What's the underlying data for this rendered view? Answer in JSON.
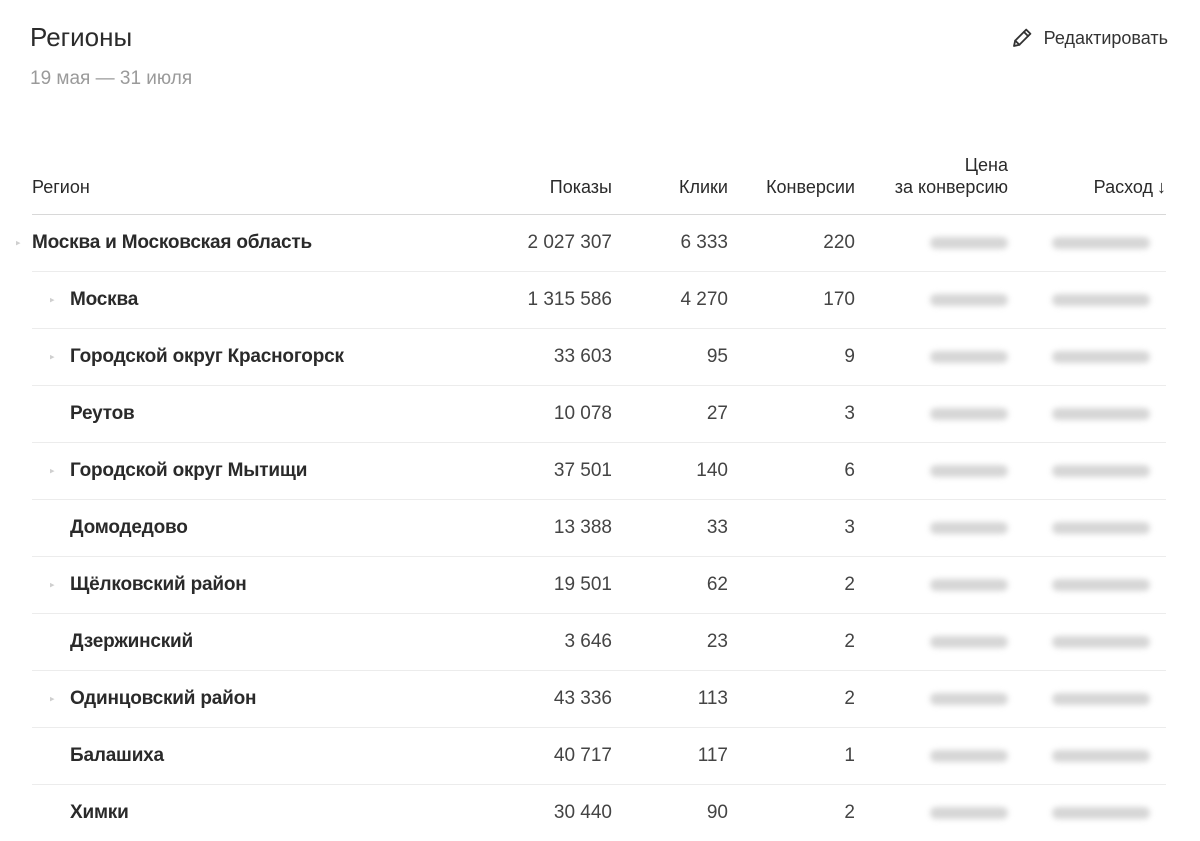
{
  "header": {
    "title": "Регионы",
    "date_range": "19 мая — 31 июля",
    "edit_label": "Редактировать",
    "edit_icon": "pencil-icon"
  },
  "table": {
    "columns": {
      "region": "Регион",
      "shows": "Показы",
      "clicks": "Клики",
      "conversions": "Конверсии",
      "price_line1": "Цена",
      "price_line2": "за конверсию",
      "spend": "Расход",
      "sort_arrow": "↓"
    },
    "rows": [
      {
        "name": "Москва и Московская область",
        "shows": "2 027 307",
        "clicks": "6 333",
        "conversions": "220",
        "level": "parent",
        "expandable": true
      },
      {
        "name": "Москва",
        "shows": "1 315 586",
        "clicks": "4 270",
        "conversions": "170",
        "level": "child",
        "expandable": true
      },
      {
        "name": "Городской округ Красногорск",
        "shows": "33 603",
        "clicks": "95",
        "conversions": "9",
        "level": "child",
        "expandable": true
      },
      {
        "name": "Реутов",
        "shows": "10 078",
        "clicks": "27",
        "conversions": "3",
        "level": "child",
        "expandable": false
      },
      {
        "name": "Городской округ Мытищи",
        "shows": "37 501",
        "clicks": "140",
        "conversions": "6",
        "level": "child",
        "expandable": true
      },
      {
        "name": "Домодедово",
        "shows": "13 388",
        "clicks": "33",
        "conversions": "3",
        "level": "child",
        "expandable": false
      },
      {
        "name": "Щёлковский район",
        "shows": "19 501",
        "clicks": "62",
        "conversions": "2",
        "level": "child",
        "expandable": true
      },
      {
        "name": "Дзержинский",
        "shows": "3 646",
        "clicks": "23",
        "conversions": "2",
        "level": "child",
        "expandable": false
      },
      {
        "name": "Одинцовский район",
        "shows": "43 336",
        "clicks": "113",
        "conversions": "2",
        "level": "child",
        "expandable": true
      },
      {
        "name": "Балашиха",
        "shows": "40 717",
        "clicks": "117",
        "conversions": "1",
        "level": "child",
        "expandable": false
      },
      {
        "name": "Химки",
        "shows": "30 440",
        "clicks": "90",
        "conversions": "2",
        "level": "child",
        "expandable": false
      }
    ]
  }
}
